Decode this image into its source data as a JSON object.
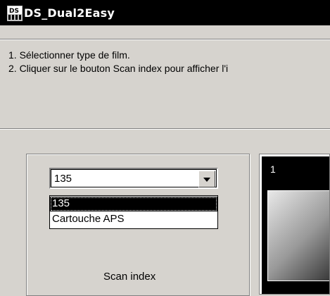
{
  "window": {
    "title": "DS_Dual2Easy",
    "icon": "ds-app-icon"
  },
  "instructions": {
    "line1": "1. Sélectionner type de film.",
    "line2": "2. Cliquer sur le bouton Scan index pour afficher l'i"
  },
  "film_type": {
    "selected_value": "135",
    "options": [
      "135",
      "Cartouche APS"
    ],
    "highlighted_index": 0
  },
  "scan_button": {
    "label": "Scan index"
  },
  "thumbnail": {
    "frame_number": "1"
  }
}
